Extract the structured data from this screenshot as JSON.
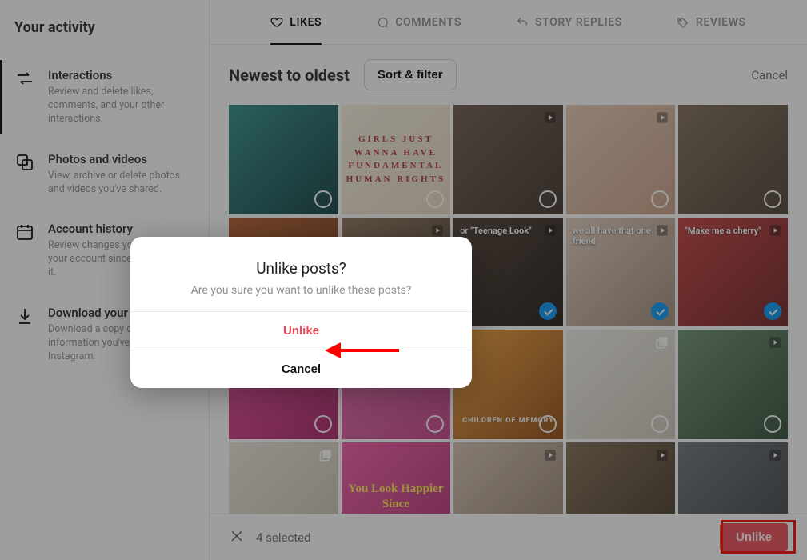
{
  "sidebar": {
    "title": "Your activity",
    "items": [
      {
        "label": "Interactions",
        "desc": "Review and delete likes, comments, and your other interactions."
      },
      {
        "label": "Photos and videos",
        "desc": "View, archive or delete photos and videos you've shared."
      },
      {
        "label": "Account history",
        "desc": "Review changes you've made to your account since you created it."
      },
      {
        "label": "Download your information",
        "desc": "Download a copy of the information you've shared with Instagram."
      }
    ]
  },
  "tabs": {
    "likes": "LIKES",
    "comments": "COMMENTS",
    "story_replies": "STORY REPLIES",
    "reviews": "REVIEWS"
  },
  "toolbar": {
    "sort_label": "Newest to oldest",
    "filter_btn": "Sort & filter",
    "cancel": "Cancel"
  },
  "grid": {
    "tiles": [
      {
        "c1": "#2e8b8b",
        "c2": "#0d3b3b",
        "badge": "",
        "sel": false,
        "text": ""
      },
      {
        "c1": "#f7f1e0",
        "c2": "#e8d9c0",
        "badge": "",
        "sel": false,
        "text": "GIRLS JUST WANNA HAVE FUNDAMENTAL HUMAN RIGHTS",
        "text_style": "poster-red"
      },
      {
        "c1": "#6b584b",
        "c2": "#3b2f27",
        "badge": "reel",
        "sel": false,
        "text": ""
      },
      {
        "c1": "#e4c8b2",
        "c2": "#c79f85",
        "badge": "reel",
        "sel": false,
        "text": ""
      },
      {
        "c1": "#7d6a55",
        "c2": "#4a3e31",
        "badge": "",
        "sel": false,
        "text": ""
      },
      {
        "c1": "#b45b2a",
        "c2": "#6b3417",
        "badge": "",
        "sel": false,
        "text": ""
      },
      {
        "c1": "#8c7258",
        "c2": "#4d3d2d",
        "badge": "reel",
        "sel": false,
        "text": ""
      },
      {
        "c1": "#4b3b30",
        "c2": "#1f1712",
        "badge": "reel",
        "sel": true,
        "text": "or \"Teenage Look\"",
        "text_style": "top-white"
      },
      {
        "c1": "#dfcdbf",
        "c2": "#a08a77",
        "badge": "reel",
        "sel": true,
        "text": "we all have that one friend",
        "text_style": "top-white"
      },
      {
        "c1": "#c23a3a",
        "c2": "#6e1f1f",
        "badge": "reel",
        "sel": true,
        "text": "\"Make me a cherry\"",
        "text_style": "top-white"
      },
      {
        "c1": "#ef4fa0",
        "c2": "#a71f64",
        "badge": "",
        "sel": false,
        "text": ""
      },
      {
        "c1": "#e96fb0",
        "c2": "#c43f86",
        "badge": "multi",
        "sel": false,
        "text": ""
      },
      {
        "c1": "#f2a03a",
        "c2": "#904a10",
        "badge": "",
        "sel": false,
        "text": "CHILDREN OF MEMORY",
        "text_style": "small-center-white"
      },
      {
        "c1": "#f1efe9",
        "c2": "#cfc8b9",
        "badge": "multi",
        "sel": false,
        "text": ""
      },
      {
        "c1": "#6b8f70",
        "c2": "#2f4a34",
        "badge": "reel",
        "sel": false,
        "text": ""
      },
      {
        "c1": "#ece6da",
        "c2": "#c7bfae",
        "badge": "multi",
        "sel": false,
        "text": ""
      },
      {
        "c1": "#f15ba6",
        "c2": "#b02b6e",
        "badge": "",
        "sel": false,
        "text": "You Look Happier Since",
        "text_style": "yellow-center"
      },
      {
        "c1": "#d3c1af",
        "c2": "#8e7c68",
        "badge": "reel",
        "sel": false,
        "text": ""
      },
      {
        "c1": "#7e6a4f",
        "c2": "#3e3120",
        "badge": "reel",
        "sel": false,
        "text": ""
      },
      {
        "c1": "#6c7378",
        "c2": "#363a3e",
        "badge": "reel",
        "sel": false,
        "text": ""
      }
    ]
  },
  "bottombar": {
    "count_label": "4 selected",
    "unlike": "Unlike"
  },
  "dialog": {
    "title": "Unlike posts?",
    "subtitle": "Are you sure you want to unlike these posts?",
    "confirm": "Unlike",
    "cancel": "Cancel"
  }
}
